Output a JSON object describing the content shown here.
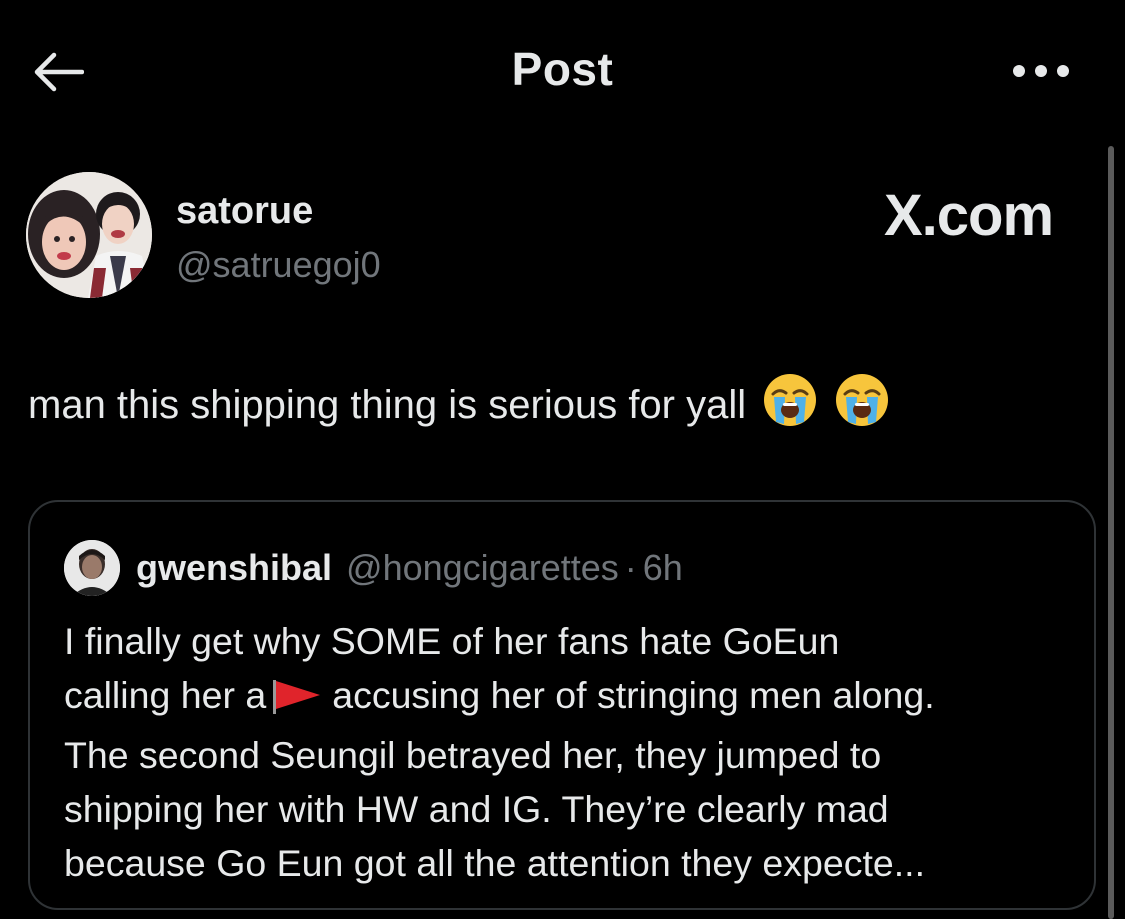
{
  "header": {
    "title": "Post",
    "back_icon": "arrow-left-icon",
    "more_icon": "more-horizontal-icon"
  },
  "post": {
    "author": {
      "display_name": "satorue",
      "handle": "@satruegoj0"
    },
    "brand_text": "X.com",
    "text": "man this shipping thing is serious for yall",
    "emojis": [
      "loudly-crying-face-icon",
      "loudly-crying-face-icon"
    ]
  },
  "quoted_post": {
    "author": {
      "display_name": "gwenshibal",
      "handle": "@hongcigarettes",
      "separator": "·",
      "time": "6h"
    },
    "lines": {
      "l1": "I finally get why SOME of her fans hate GoEun",
      "l2a": "calling her a",
      "l2b": "accusing her of stringing men along.",
      "l3": "The second Seungil betrayed her, they jumped to",
      "l4": "shipping her with HW and IG. They’re clearly mad",
      "l5": "because Go Eun got all the attention they expecte..."
    },
    "inline_icon": "red-flag-icon"
  },
  "colors": {
    "background": "#000000",
    "text_primary": "#e7e9ea",
    "text_secondary": "#71767b",
    "border": "#2f3336",
    "flag_red": "#e0242b"
  }
}
